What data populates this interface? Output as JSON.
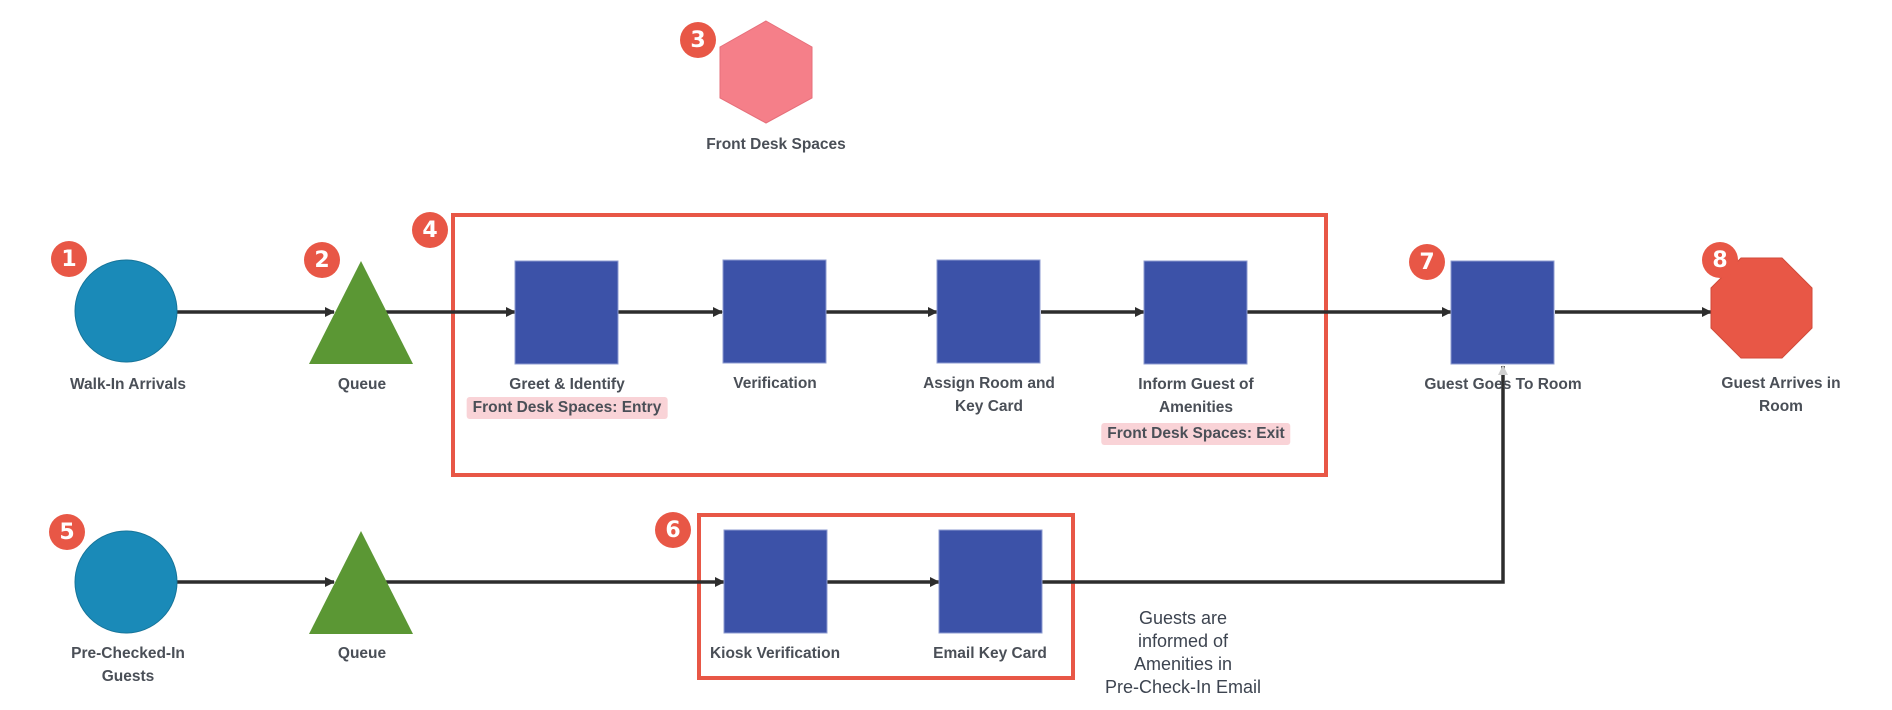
{
  "colors": {
    "start": "#1a8ab8",
    "queue": "#5b9734",
    "process": "#3c52a8",
    "resource": "#f57f89",
    "end": "#e85746",
    "group_border": "#e85746",
    "connector": "#2d2d2d",
    "badge": "#e85746",
    "tag_bg": "#f9d3d7"
  },
  "resource": {
    "badge": "3",
    "label": "Front Desk Spaces"
  },
  "walk_in_flow": {
    "start": {
      "badge": "1",
      "label": "Walk-In Arrivals"
    },
    "queue": {
      "badge": "2",
      "label": "Queue"
    },
    "group": {
      "badge": "4"
    },
    "steps": [
      {
        "label": "Greet & Identify",
        "tag": "Front Desk Spaces: Entry"
      },
      {
        "label": "Verification"
      },
      {
        "label_line1": "Assign Room and",
        "label_line2": "Key Card"
      },
      {
        "label_line1": "Inform Guest of",
        "label_line2": "Amenities",
        "tag": "Front Desk Spaces: Exit"
      }
    ],
    "goes_to_room": {
      "badge": "7",
      "label": "Guest Goes To Room"
    },
    "end": {
      "badge": "8",
      "label_line1": "Guest Arrives in",
      "label_line2": "Room"
    }
  },
  "pre_checked_flow": {
    "start": {
      "badge": "5",
      "label_line1": "Pre-Checked-In",
      "label_line2": "Guests"
    },
    "queue": {
      "label": "Queue"
    },
    "group": {
      "badge": "6"
    },
    "steps": [
      {
        "label": "Kiosk Verification"
      },
      {
        "label": "Email Key Card"
      }
    ],
    "note": [
      "Guests are",
      "informed of",
      "Amenities in",
      "Pre-Check-In Email"
    ]
  }
}
